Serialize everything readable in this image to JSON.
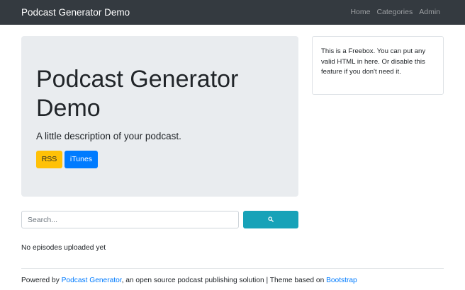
{
  "navbar": {
    "brand": "Podcast Generator Demo",
    "links": [
      "Home",
      "Categories",
      "Admin"
    ]
  },
  "jumbotron": {
    "title": "Podcast Generator Demo",
    "description": "A little description of your podcast.",
    "rss_label": "RSS",
    "itunes_label": "iTunes"
  },
  "freebox": {
    "text": "This is a Freebox. You can put any valid HTML in here. Or disable this feature if you don't need it."
  },
  "search": {
    "placeholder": "Search...",
    "icon": "search-icon"
  },
  "episodes": {
    "empty_message": "No episodes uploaded yet"
  },
  "footer": {
    "prefix": "Powered by ",
    "generator_link": "Podcast Generator",
    "middle": ", an open source podcast publishing solution | Theme based on ",
    "bootstrap_link": "Bootstrap"
  },
  "colors": {
    "navbar_bg": "#343a40",
    "jumbotron_bg": "#e9ecef",
    "rss_button": "#ffc107",
    "itunes_button": "#007bff",
    "search_button": "#17a2b8",
    "link": "#007bff"
  }
}
